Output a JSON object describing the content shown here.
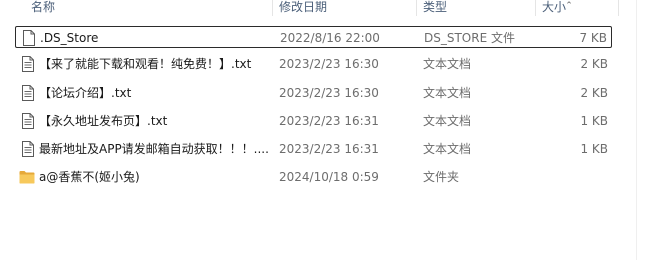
{
  "columns": {
    "name": "名称",
    "modified": "修改日期",
    "type": "类型",
    "size": "大小"
  },
  "files": [
    {
      "name": ".DS_Store",
      "modified": "2022/8/16 22:00",
      "type": "DS_STORE 文件",
      "size": "7 KB",
      "icon": "file-icon",
      "focused": true
    },
    {
      "name": "【来了就能下载和观看！纯免费！】.txt",
      "modified": "2023/2/23 16:30",
      "type": "文本文档",
      "size": "2 KB",
      "icon": "text-file-icon"
    },
    {
      "name": "【论坛介绍】.txt",
      "modified": "2023/2/23 16:30",
      "type": "文本文档",
      "size": "2 KB",
      "icon": "text-file-icon"
    },
    {
      "name": "【永久地址发布页】.txt",
      "modified": "2023/2/23 16:31",
      "type": "文本文档",
      "size": "1 KB",
      "icon": "text-file-icon"
    },
    {
      "name": "最新地址及APP请发邮箱自动获取！！！....",
      "modified": "2023/2/23 16:31",
      "type": "文本文档",
      "size": "1 KB",
      "icon": "text-file-icon"
    },
    {
      "name": "a@香蕉不(姬小兔)",
      "modified": "2024/10/18 0:59",
      "type": "文件夹",
      "size": "",
      "icon": "folder-icon"
    }
  ],
  "colors": {
    "header_text": "#4c607a",
    "secondary_text": "#6d6d6d",
    "folder": "#f4c14d"
  }
}
